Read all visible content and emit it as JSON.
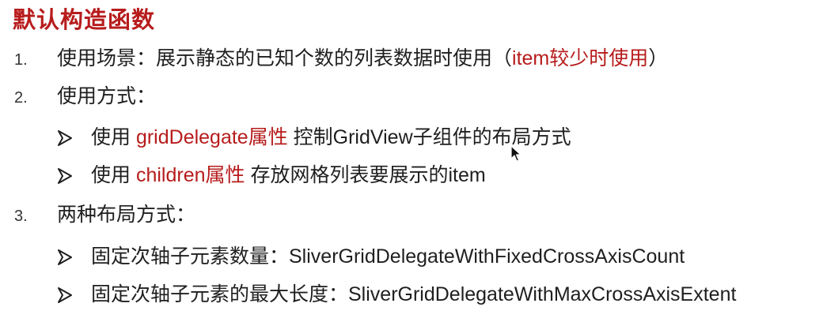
{
  "title": "默认构造函数",
  "items": [
    {
      "number": "1.",
      "text_before": "使用场景：展示静态的已知个数的列表数据时使用（",
      "highlight": "item较少时使用",
      "text_after": "）"
    },
    {
      "number": "2.",
      "text": "使用方式：",
      "subitems": [
        {
          "prefix": "使用 ",
          "highlight": "gridDelegate属性",
          "suffix": " 控制GridView子组件的布局方式"
        },
        {
          "prefix": "使用 ",
          "highlight": "children属性",
          "suffix": " 存放网格列表要展示的item"
        }
      ]
    },
    {
      "number": "3.",
      "text": "两种布局方式：",
      "subitems": [
        {
          "text": "固定次轴子元素数量：SliverGridDelegateWithFixedCrossAxisCount"
        },
        {
          "text": "固定次轴子元素的最大长度：SliverGridDelegateWithMaxCrossAxisExtent"
        }
      ]
    }
  ],
  "colors": {
    "accent": "#b71c1c",
    "text": "#1f1f1f"
  },
  "icons": {
    "bullet": "arrow-bullet-icon",
    "cursor": "mouse-cursor-icon"
  }
}
